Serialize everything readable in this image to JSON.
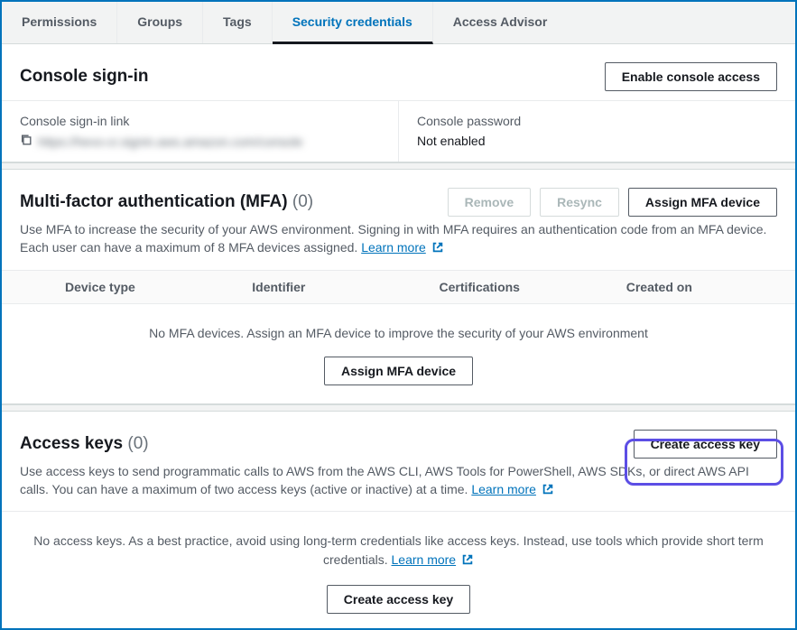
{
  "tabs": {
    "permissions": "Permissions",
    "groups": "Groups",
    "tags": "Tags",
    "security_credentials": "Security credentials",
    "access_advisor": "Access Advisor"
  },
  "console_signin": {
    "title": "Console sign-in",
    "enable_button": "Enable console access",
    "link_label": "Console sign-in link",
    "link_value": "https://hevo-cr.signin.aws.amazon.com/console",
    "password_label": "Console password",
    "password_value": "Not enabled"
  },
  "mfa": {
    "title": "Multi-factor authentication (MFA)",
    "count": "(0)",
    "remove_button": "Remove",
    "resync_button": "Resync",
    "assign_button": "Assign MFA device",
    "description": "Use MFA to increase the security of your AWS environment. Signing in with MFA requires an authentication code from an MFA device. Each user can have a maximum of 8 MFA devices assigned. ",
    "learn_more": "Learn more",
    "columns": {
      "device_type": "Device type",
      "identifier": "Identifier",
      "certifications": "Certifications",
      "created_on": "Created on"
    },
    "empty_text": "No MFA devices. Assign an MFA device to improve the security of your AWS environment",
    "empty_button": "Assign MFA device"
  },
  "access_keys": {
    "title": "Access keys",
    "count": "(0)",
    "create_button": "Create access key",
    "description": "Use access keys to send programmatic calls to AWS from the AWS CLI, AWS Tools for PowerShell, AWS SDKs, or direct AWS API calls. You can have a maximum of two access keys (active or inactive) at a time. ",
    "learn_more": "Learn more",
    "empty_text": "No access keys. As a best practice, avoid using long-term credentials like access keys. Instead, use tools which provide short term credentials. ",
    "empty_learn_more": "Learn more",
    "empty_button": "Create access key"
  }
}
